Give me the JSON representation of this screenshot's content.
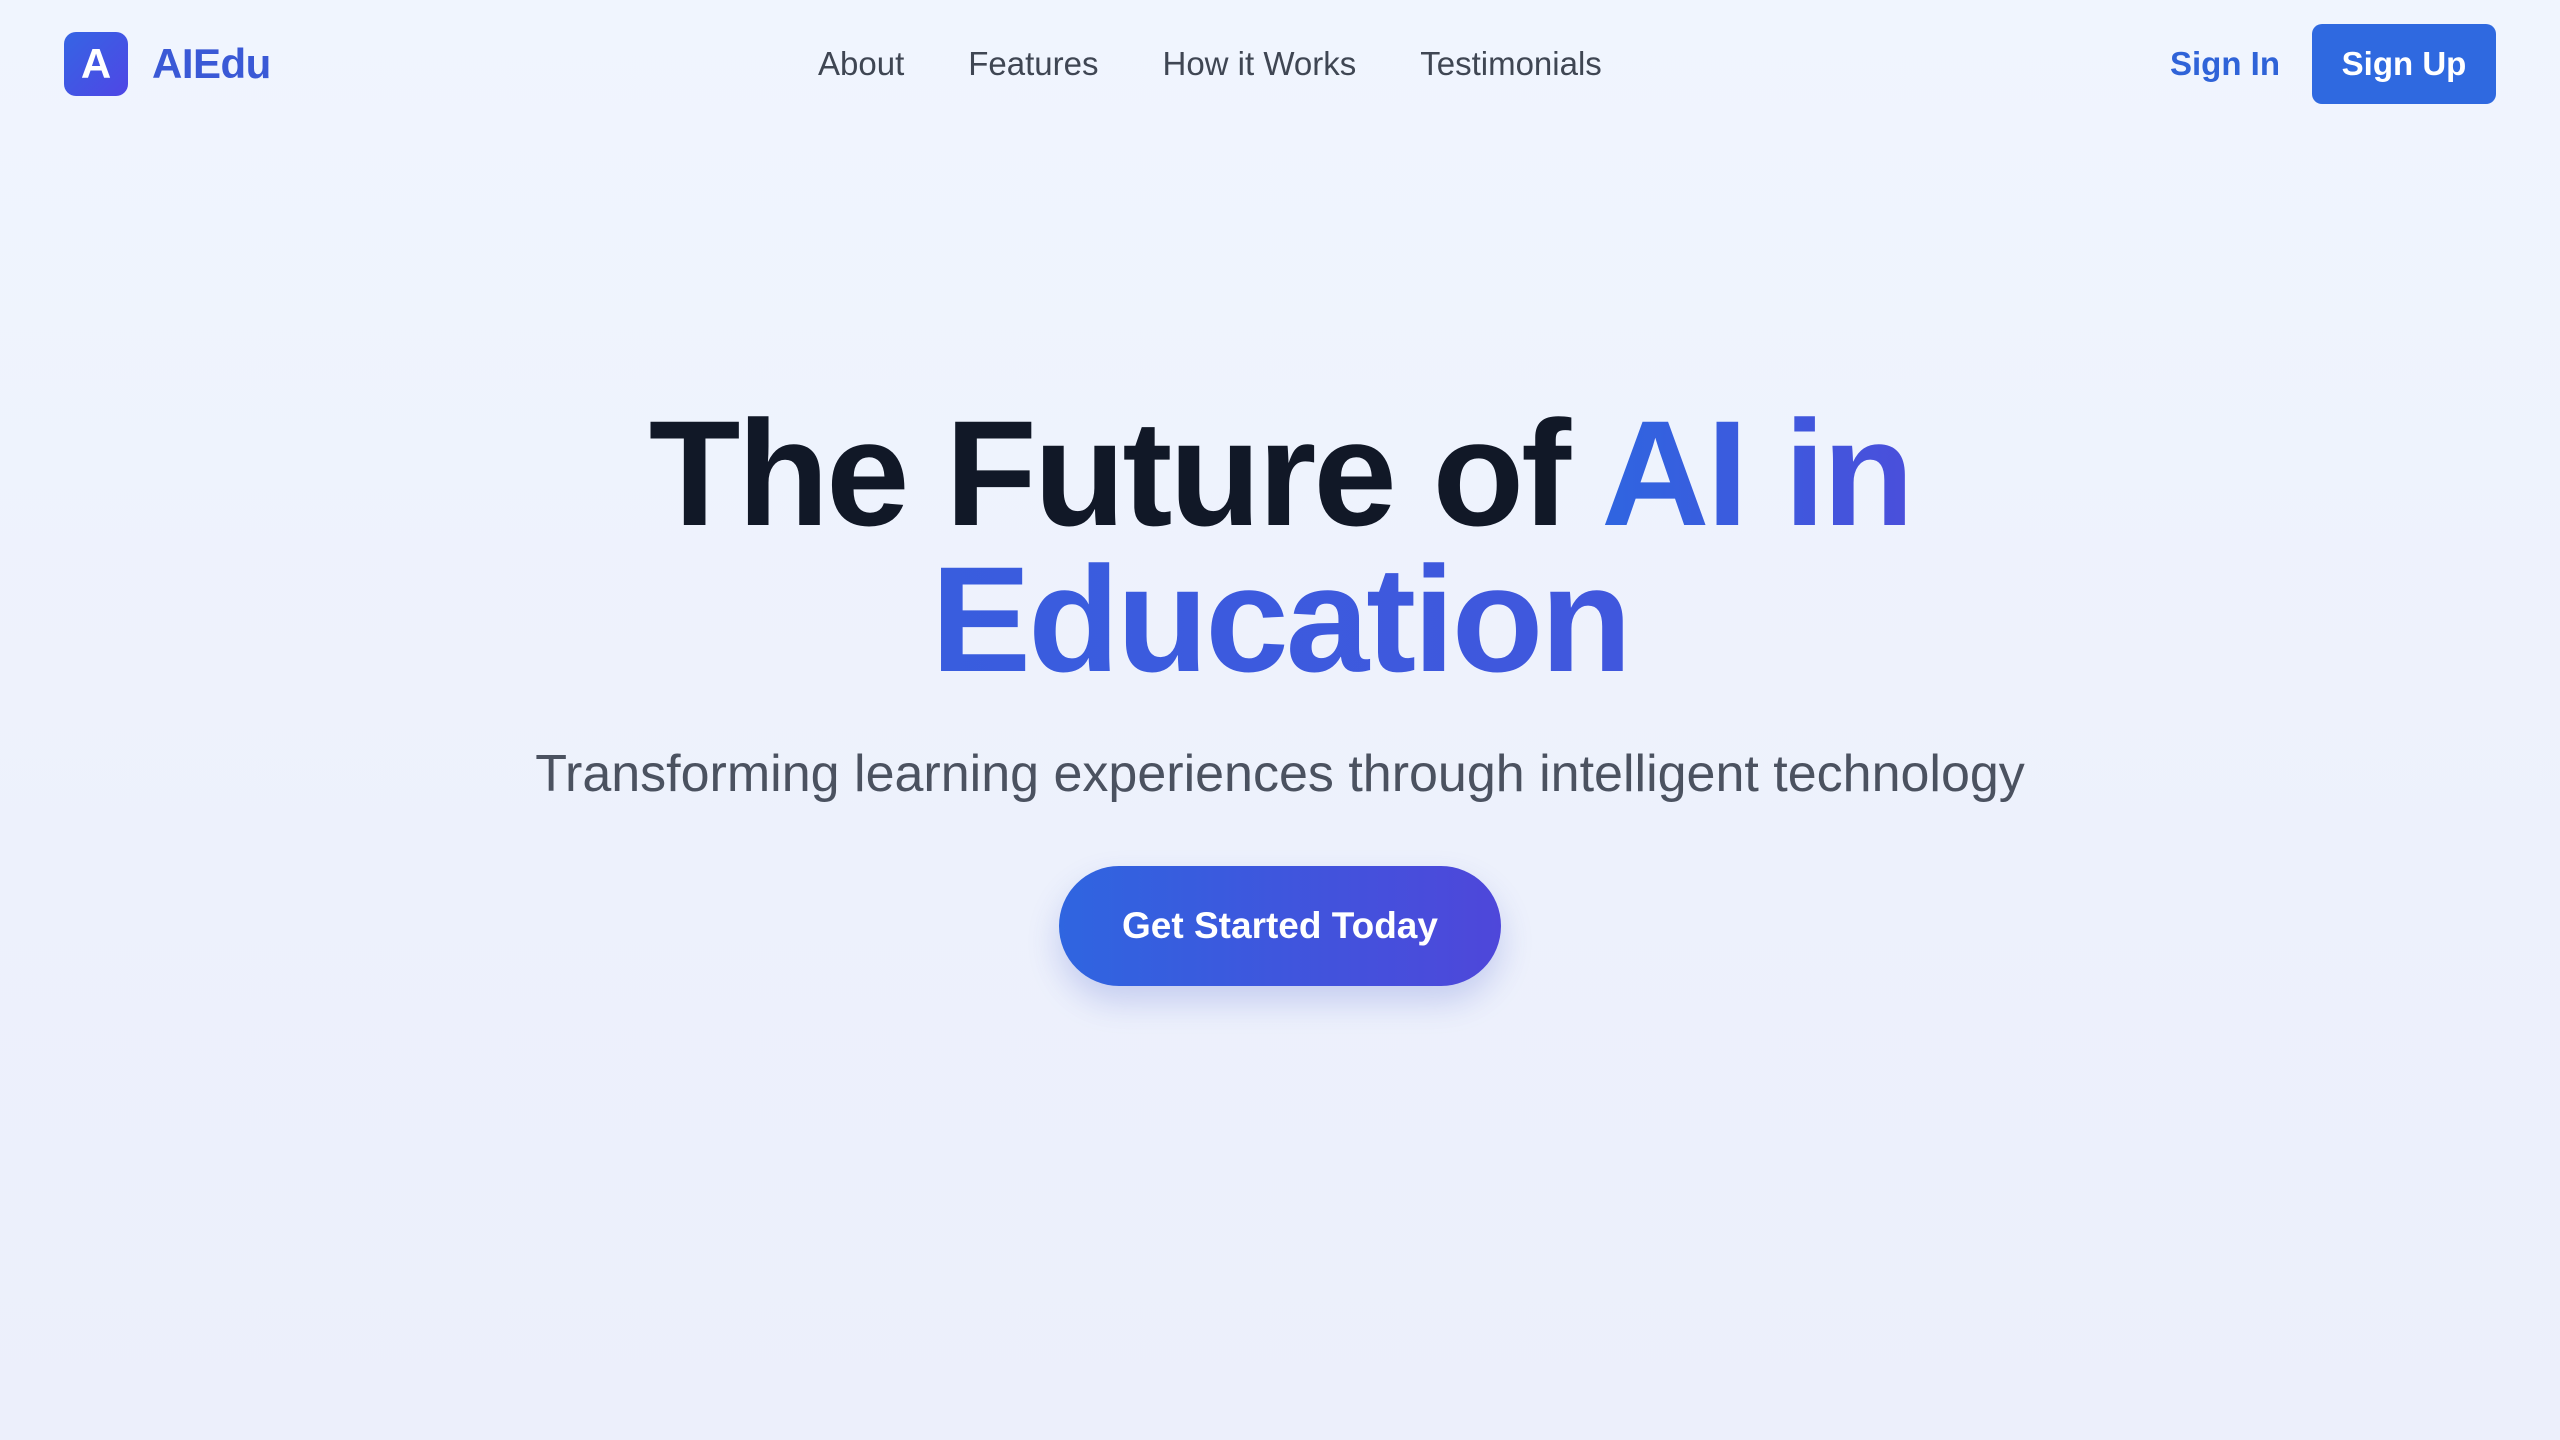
{
  "brand": {
    "logo_letter": "A",
    "name": "AIEdu"
  },
  "nav": {
    "items": [
      {
        "label": "About"
      },
      {
        "label": "Features"
      },
      {
        "label": "How it Works"
      },
      {
        "label": "Testimonials"
      }
    ]
  },
  "auth": {
    "sign_in_label": "Sign In",
    "sign_up_label": "Sign Up"
  },
  "hero": {
    "title_part1": "The Future of ",
    "title_accent1": "AI in",
    "title_accent2": "Education",
    "subtitle": "Transforming learning experiences through intelligent technology",
    "cta_label": "Get Started Today"
  },
  "colors": {
    "primary": "#2f69e0",
    "brand_text": "#3a59d6",
    "heading": "#111827",
    "gradient_end": "#4f46e5"
  }
}
